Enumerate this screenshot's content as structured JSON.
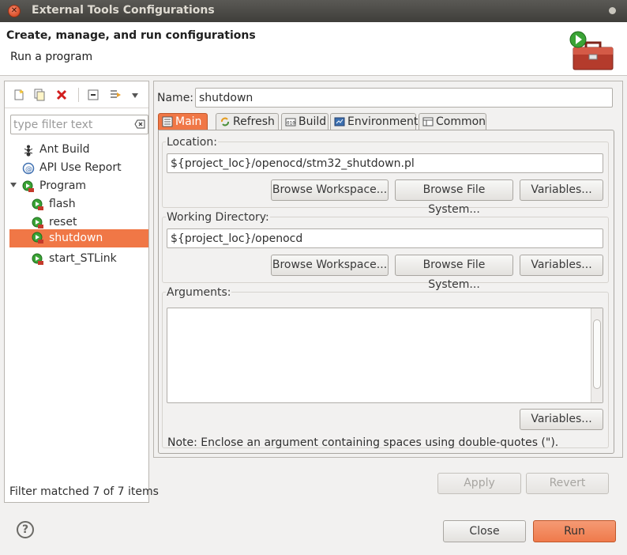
{
  "window": {
    "title": "External Tools Configurations"
  },
  "header": {
    "title": "Create, manage, and run configurations",
    "subtitle": "Run a program"
  },
  "left": {
    "toolbar_icons": [
      "new-configuration-icon",
      "duplicate-icon",
      "delete-icon",
      "collapse-all-icon",
      "filter-icon",
      "view-menu-icon"
    ],
    "filter_placeholder": "type filter text",
    "tree": [
      {
        "label": "Ant Build"
      },
      {
        "label": "API Use Report"
      },
      {
        "label": "Program"
      },
      {
        "label": "flash"
      },
      {
        "label": "reset"
      },
      {
        "label": "shutdown"
      },
      {
        "label": "start_STLink"
      }
    ],
    "status": "Filter matched 7 of 7 items"
  },
  "right": {
    "name_label": "Name:",
    "name_value": "shutdown",
    "tabs": [
      {
        "label": "Main",
        "icon": "main-tab-icon"
      },
      {
        "label": "Refresh",
        "icon": "refresh-icon"
      },
      {
        "label": "Build",
        "icon": "build-icon"
      },
      {
        "label": "Environment",
        "icon": "environment-icon"
      },
      {
        "label": "Common",
        "icon": "common-icon"
      }
    ],
    "location": {
      "label": "Location:",
      "value": "${project_loc}/openocd/stm32_shutdown.pl",
      "browse_workspace": "Browse Workspace...",
      "browse_fs": "Browse File System...",
      "variables": "Variables..."
    },
    "workdir": {
      "label": "Working Directory:",
      "value": "${project_loc}/openocd",
      "browse_workspace": "Browse Workspace...",
      "browse_fs": "Browse File System...",
      "variables": "Variables..."
    },
    "arguments": {
      "label": "Arguments:",
      "value": "",
      "variables": "Variables...",
      "note": "Note: Enclose an argument containing spaces using double-quotes (\")."
    },
    "apply": "Apply",
    "revert": "Revert"
  },
  "footer": {
    "help": "?",
    "close": "Close",
    "run": "Run"
  },
  "colors": {
    "selection": "#f07746",
    "titlebar": "#3f3e3a",
    "background": "#f2f1f0"
  }
}
